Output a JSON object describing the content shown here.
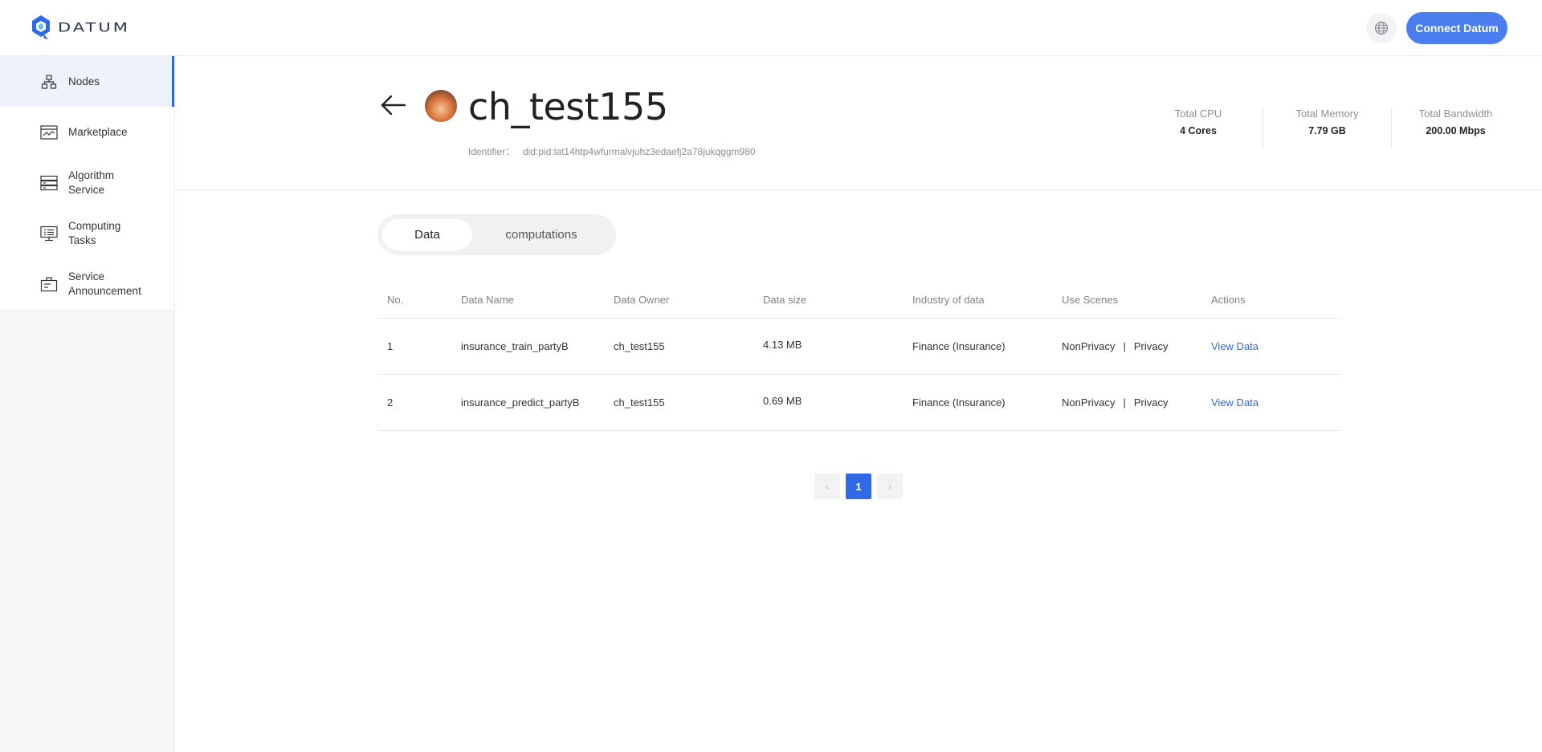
{
  "app": {
    "brand": "DATUM",
    "connect_label": "Connect Datum",
    "language_icon": "globe-icon"
  },
  "sidebar": {
    "items": [
      {
        "label": "Nodes",
        "icon": "nodes-icon",
        "active": true
      },
      {
        "label": "Marketplace",
        "icon": "marketplace-icon"
      },
      {
        "label": "Algorithm Service",
        "icon": "algorithm-icon"
      },
      {
        "label": "Computing Tasks",
        "icon": "computing-tasks-icon"
      },
      {
        "label": "Service Announcement",
        "icon": "announcement-icon"
      }
    ]
  },
  "node": {
    "name": "ch_test155",
    "identifier_label": "Identifier：",
    "identifier_value": "did:pid:lat14htp4wfurmalvjuhz3edaefj2a78jukqggm980",
    "stats": [
      {
        "label": "Total CPU",
        "value": "4 Cores"
      },
      {
        "label": "Total Memory",
        "value": "7.79 GB"
      },
      {
        "label": "Total Bandwidth",
        "value": "200.00 Mbps"
      }
    ]
  },
  "tabs": [
    {
      "label": "Data",
      "active": true
    },
    {
      "label": "computations",
      "active": false
    }
  ],
  "table": {
    "columns": [
      "No.",
      "Data Name",
      "Data Owner",
      "Data size",
      "Industry of data",
      "Use Scenes",
      "Actions"
    ],
    "rows": [
      {
        "no": "1",
        "name": "insurance_train_partyB",
        "owner": "ch_test155",
        "size": "4.13 MB",
        "industry": "Finance (Insurance)",
        "scene_a": "NonPrivacy",
        "sep": "|",
        "scene_b": "Privacy",
        "action": "View Data"
      },
      {
        "no": "2",
        "name": "insurance_predict_partyB",
        "owner": "ch_test155",
        "size": "0.69 MB",
        "industry": "Finance (Insurance)",
        "scene_a": "NonPrivacy",
        "sep": "|",
        "scene_b": "Privacy",
        "action": "View Data"
      }
    ]
  },
  "pagination": {
    "prev": "‹",
    "current": "1",
    "next": "›"
  },
  "colors": {
    "accent": "#2f6ae6",
    "connect_button": "#4a7ef0"
  }
}
